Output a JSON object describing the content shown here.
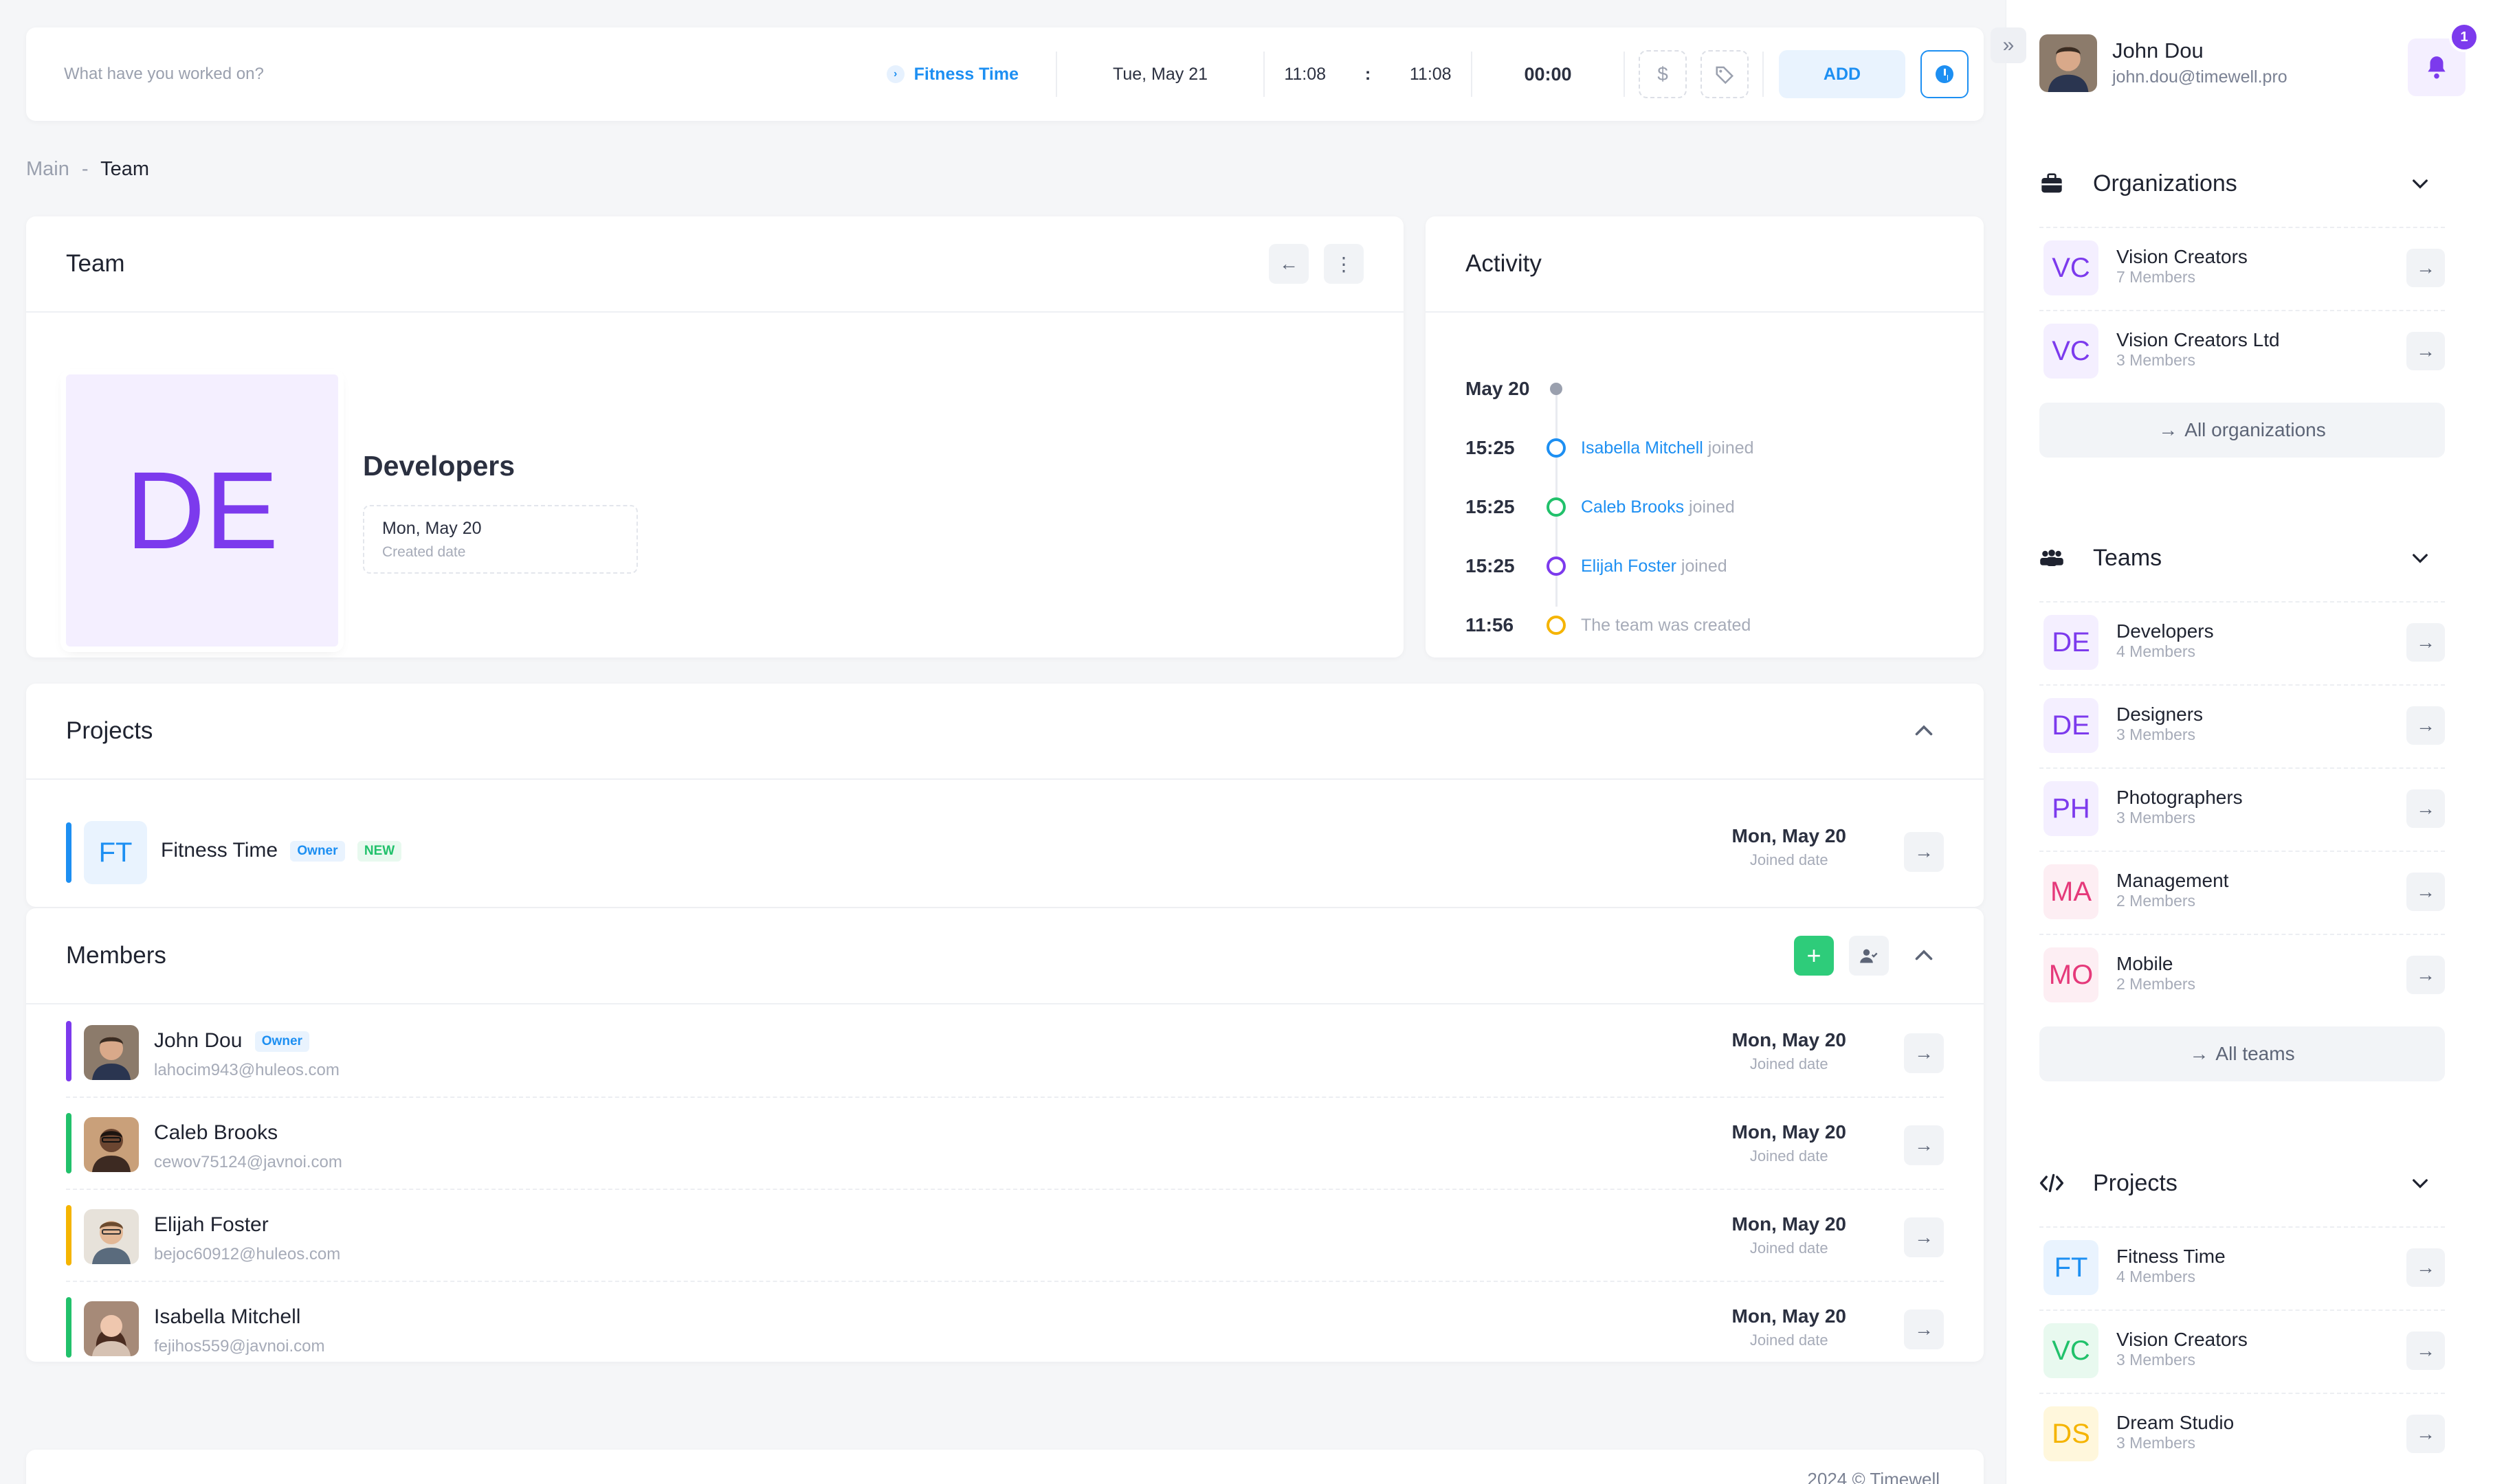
{
  "timer": {
    "task_placeholder": "What have you worked on?",
    "project": "Fitness Time",
    "date": "Tue, May 21",
    "start": "11:08",
    "separator": ":",
    "end": "11:08",
    "duration": "00:00",
    "billable_icon": "$",
    "add_label": "ADD"
  },
  "breadcrumb": {
    "root": "Main",
    "sep": "-",
    "current": "Team"
  },
  "team": {
    "title": "Team",
    "initials": "DE",
    "name": "Developers",
    "created_value": "Mon, May 20",
    "created_label": "Created date"
  },
  "activity": {
    "title": "Activity",
    "date": "May 20",
    "items": [
      {
        "time": "15:25",
        "who": "Isabella Mitchell",
        "text": " joined",
        "color": "#1d8ff2"
      },
      {
        "time": "15:25",
        "who": "Caleb Brooks",
        "text": " joined",
        "color": "#21c16b"
      },
      {
        "time": "15:25",
        "who": "Elijah Foster",
        "text": " joined",
        "color": "#7c3aed"
      },
      {
        "time": "11:56",
        "who": "",
        "text": "The team was created",
        "color": "#f5b400"
      }
    ]
  },
  "projects": {
    "title": "Projects",
    "rows": [
      {
        "initials": "FT",
        "name": "Fitness Time",
        "tag_owner": "Owner",
        "tag_new": "NEW",
        "joined": "Mon, May 20",
        "joined_label": "Joined date"
      }
    ]
  },
  "members": {
    "title": "Members",
    "rows": [
      {
        "name": "John Dou",
        "tag": "Owner",
        "email": "lahocim943@huleos.com",
        "joined": "Mon, May 20",
        "joined_label": "Joined date",
        "color": "#7c3aed"
      },
      {
        "name": "Caleb Brooks",
        "tag": "",
        "email": "cewov75124@javnoi.com",
        "joined": "Mon, May 20",
        "joined_label": "Joined date",
        "color": "#21c16b"
      },
      {
        "name": "Elijah Foster",
        "tag": "",
        "email": "bejoc60912@huleos.com",
        "joined": "Mon, May 20",
        "joined_label": "Joined date",
        "color": "#f5b400"
      },
      {
        "name": "Isabella Mitchell",
        "tag": "",
        "email": "fejihos559@javnoi.com",
        "joined": "Mon, May 20",
        "joined_label": "Joined date",
        "color": "#21c16b"
      }
    ]
  },
  "footer": {
    "text": "2024 © Timewell"
  },
  "user": {
    "name": "John Dou",
    "email": "john.dou@timewell.pro",
    "notifications": "1"
  },
  "organizations": {
    "title": "Organizations",
    "items": [
      {
        "initials": "VC",
        "name": "Vision Creators",
        "members": "7 Members"
      },
      {
        "initials": "VC",
        "name": "Vision Creators Ltd",
        "members": "3 Members"
      }
    ],
    "all_label": "All organizations"
  },
  "teams": {
    "title": "Teams",
    "items": [
      {
        "initials": "DE",
        "name": "Developers",
        "members": "4 Members"
      },
      {
        "initials": "DE",
        "name": "Designers",
        "members": "3 Members"
      },
      {
        "initials": "PH",
        "name": "Photographers",
        "members": "3 Members"
      },
      {
        "initials": "MA",
        "name": "Management",
        "members": "2 Members"
      },
      {
        "initials": "MO",
        "name": "Mobile",
        "members": "2 Members"
      }
    ],
    "all_label": "All teams"
  },
  "sb_projects": {
    "title": "Projects",
    "items": [
      {
        "initials": "FT",
        "name": "Fitness Time",
        "members": "4 Members"
      },
      {
        "initials": "VC",
        "name": "Vision Creators",
        "members": "3 Members"
      },
      {
        "initials": "DS",
        "name": "Dream Studio",
        "members": "3 Members"
      }
    ]
  },
  "colors": {
    "accent": "#1d8ff2",
    "purple": "#7c3aed",
    "green": "#21c16b",
    "yellow": "#f5b400",
    "pink": "#e5397a"
  }
}
